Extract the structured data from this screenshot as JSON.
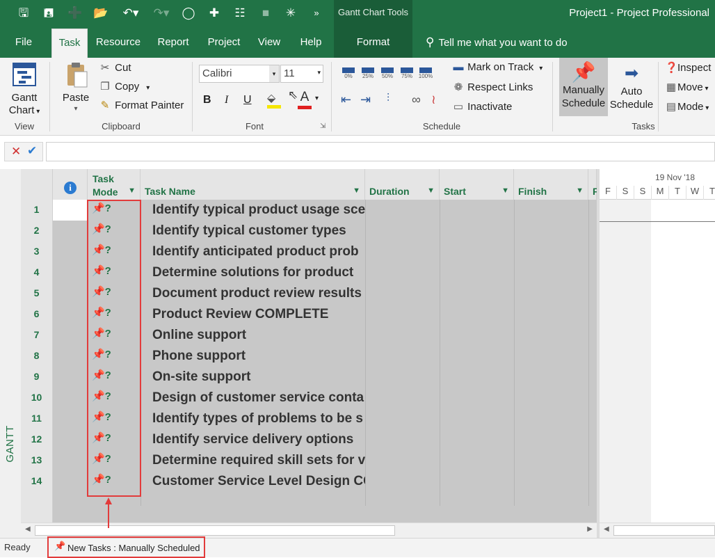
{
  "qat": {
    "icons": [
      "save-icon",
      "save-as-icon",
      "new-icon",
      "open-icon",
      "undo-icon",
      "redo-icon",
      "circle-icon",
      "add-task-icon",
      "link-icon",
      "unlink-icon",
      "move-icon",
      "more-icon"
    ]
  },
  "contextual": {
    "tools_label": "Gantt Chart Tools",
    "format_tab": "Format"
  },
  "app_title": "Project1  -  Project Professional",
  "tabs": [
    "File",
    "Task",
    "Resource",
    "Report",
    "Project",
    "View",
    "Help"
  ],
  "tell_me": "Tell me what you want to do",
  "ribbon": {
    "view": {
      "gantt_label": "Gantt",
      "gantt_label2": "Chart",
      "group": "View"
    },
    "clipboard": {
      "paste": "Paste",
      "cut": "Cut",
      "copy": "Copy",
      "format_painter": "Format Painter",
      "group": "Clipboard"
    },
    "font": {
      "family": "Calibri",
      "size": "11",
      "bold": "B",
      "italic": "I",
      "underline": "U",
      "font_color": "A",
      "group": "Font"
    },
    "schedule": {
      "pcts": [
        "0%",
        "25%",
        "50%",
        "75%",
        "100%"
      ],
      "mark_on_track": "Mark on Track",
      "respect_links": "Respect Links",
      "inactivate": "Inactivate",
      "group": "Schedule"
    },
    "tasks": {
      "manual1": "Manually",
      "manual2": "Schedule",
      "auto1": "Auto",
      "auto2": "Schedule",
      "inspect": "Inspect",
      "move": "Move",
      "mode": "Mode",
      "group": "Tasks"
    }
  },
  "grid": {
    "headers": {
      "info": "i",
      "task_mode1": "Task",
      "task_mode2": "Mode",
      "task_name": "Task Name",
      "duration": "Duration",
      "start": "Start",
      "finish": "Finish",
      "extra": "F"
    },
    "timescale": {
      "week": "19 Nov '18",
      "days": [
        "F",
        "S",
        "S",
        "M",
        "T",
        "W",
        "T"
      ]
    },
    "rows": [
      {
        "n": "1",
        "name": "Identify typical product usage sce"
      },
      {
        "n": "2",
        "name": "Identify typical customer types"
      },
      {
        "n": "3",
        "name": "Identify anticipated product prob"
      },
      {
        "n": "4",
        "name": "Determine solutions for product "
      },
      {
        "n": "5",
        "name": "Document product review results"
      },
      {
        "n": "6",
        "name": "Product Review COMPLETE"
      },
      {
        "n": "7",
        "name": "Online support"
      },
      {
        "n": "8",
        "name": "Phone support"
      },
      {
        "n": "9",
        "name": "On-site support"
      },
      {
        "n": "10",
        "name": "Design of customer service conta"
      },
      {
        "n": "11",
        "name": "Identify types of problems to be s"
      },
      {
        "n": "12",
        "name": "Identify service delivery options"
      },
      {
        "n": "13",
        "name": "Determine required skill sets for v"
      },
      {
        "n": "14",
        "name": "Customer Service Level Design CC"
      }
    ],
    "side_label": "GANTT CHART"
  },
  "status": {
    "ready": "Ready",
    "new_tasks": "New Tasks : Manually Scheduled"
  }
}
